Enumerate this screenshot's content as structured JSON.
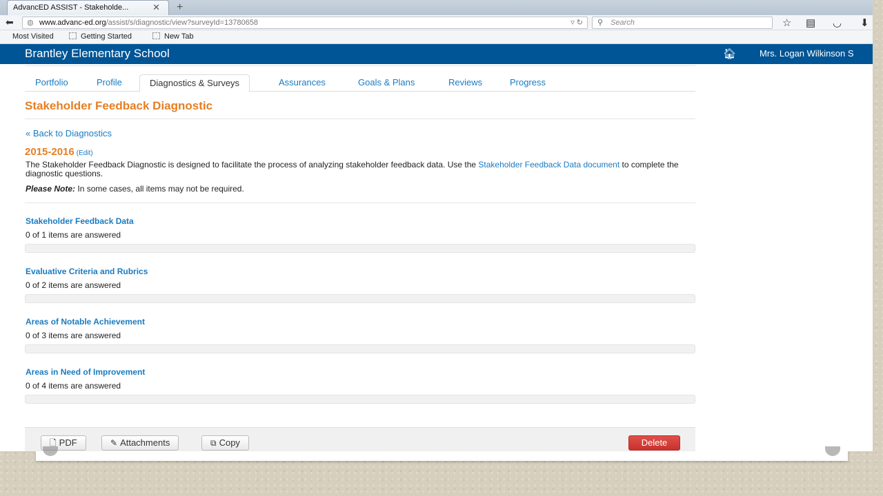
{
  "browser": {
    "tab_title": "AdvancED ASSIST - Stakeholde...",
    "tab_close": "✕",
    "new_tab": "+",
    "url_host": "www.advanc-ed.org",
    "url_path": "/assist/s/diagnostic/view?surveyId=13780658",
    "search_placeholder": "Search",
    "bookmarks": [
      "Most Visited",
      "Getting Started",
      "New Tab"
    ]
  },
  "header": {
    "school_name": "Brantley Elementary School",
    "user_name": "Mrs. Logan Wilkinson S",
    "bg_color": "#005596"
  },
  "nav_tabs": [
    {
      "label": "Portfolio",
      "active": false
    },
    {
      "label": "Profile",
      "active": false
    },
    {
      "label": "Diagnostics & Surveys",
      "active": true
    },
    {
      "label": "Assurances",
      "active": false
    },
    {
      "label": "Goals & Plans",
      "active": false
    },
    {
      "label": "Reviews",
      "active": false
    },
    {
      "label": "Progress",
      "active": false
    }
  ],
  "page": {
    "title": "Stakeholder Feedback Diagnostic",
    "back_link": "« Back to Diagnostics",
    "year": "2015-2016",
    "edit_link": "(Edit)",
    "description_prefix": "The Stakeholder Feedback Diagnostic is designed to facilitate the process of analyzing stakeholder feedback data. Use the ",
    "description_link": "Stakeholder Feedback Data document",
    "description_suffix": " to complete the diagnostic questions.",
    "note_label": "Please Note:",
    "note_text": " In some cases, all items may not be required.",
    "accent_color": "#e67e22",
    "link_color": "#1a7bc0"
  },
  "sections": [
    {
      "title": "Stakeholder Feedback Data",
      "count_text": "0 of 1 items are answered",
      "progress": 0
    },
    {
      "title": "Evaluative Criteria and Rubrics",
      "count_text": "0 of 2 items are answered",
      "progress": 0
    },
    {
      "title": "Areas of Notable Achievement",
      "count_text": "0 of 3 items are answered",
      "progress": 0
    },
    {
      "title": "Areas in Need of Improvement",
      "count_text": "0 of 4 items are answered",
      "progress": 0
    }
  ],
  "footer": {
    "pdf_label": "PDF",
    "attachments_label": "Attachments",
    "copy_label": "Copy",
    "delete_label": "Delete",
    "delete_color": "#d9534f"
  }
}
